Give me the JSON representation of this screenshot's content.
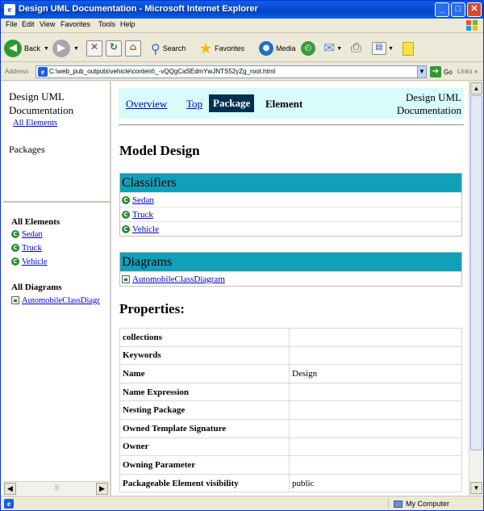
{
  "window": {
    "title": "Design UML Documentation - Microsoft Internet Explorer"
  },
  "menu": {
    "items": [
      "File",
      "Edit",
      "View",
      "Favorites",
      "Tools",
      "Help"
    ]
  },
  "toolbar": {
    "back": "Back",
    "search": "Search",
    "favorites": "Favorites",
    "media": "Media"
  },
  "address": {
    "label": "Address",
    "url": "C:\\web_pub_outputs\\vehicle\\content\\_-vQQgCaSEdmYwJNTS52yZg_root.html",
    "go": "Go",
    "links": "Links"
  },
  "left": {
    "title_line1": "Design UML",
    "title_line2": "Documentation",
    "all_elements_link": "All Elements",
    "packages_heading": "Packages",
    "all_elements_heading": "All Elements",
    "elements": [
      "Sedan",
      "Truck",
      "Vehicle"
    ],
    "all_diagrams_heading": "All Diagrams",
    "diagrams": [
      "AutomobileClassDiagr"
    ]
  },
  "nav": {
    "overview": "Overview",
    "top": "Top",
    "package": "Package",
    "element": "Element",
    "right_line1": "Design UML",
    "right_line2": "Documentation"
  },
  "main": {
    "heading": "Model Design",
    "classifiers_heading": "Classifiers",
    "classifiers": [
      "Sedan",
      "Truck",
      "Vehicle"
    ],
    "diagrams_heading": "Diagrams",
    "diagrams": [
      "AutomobileClassDiagram"
    ],
    "properties_heading": "Properties:",
    "properties": [
      {
        "key": "collections",
        "value": ""
      },
      {
        "key": "Keywords",
        "value": ""
      },
      {
        "key": "Name",
        "value": "Design"
      },
      {
        "key": "Name Expression",
        "value": ""
      },
      {
        "key": "Nesting Package",
        "value": ""
      },
      {
        "key": "Owned Template Signature",
        "value": ""
      },
      {
        "key": "Owner",
        "value": ""
      },
      {
        "key": "Owning Parameter",
        "value": ""
      },
      {
        "key": "Packageable Element visibility",
        "value": "public"
      }
    ]
  },
  "status": {
    "zone": "My Computer"
  },
  "icons": {
    "class": "class-icon",
    "diagram": "diagram-icon",
    "ie": "ie-page-icon",
    "computer": "computer-icon"
  }
}
